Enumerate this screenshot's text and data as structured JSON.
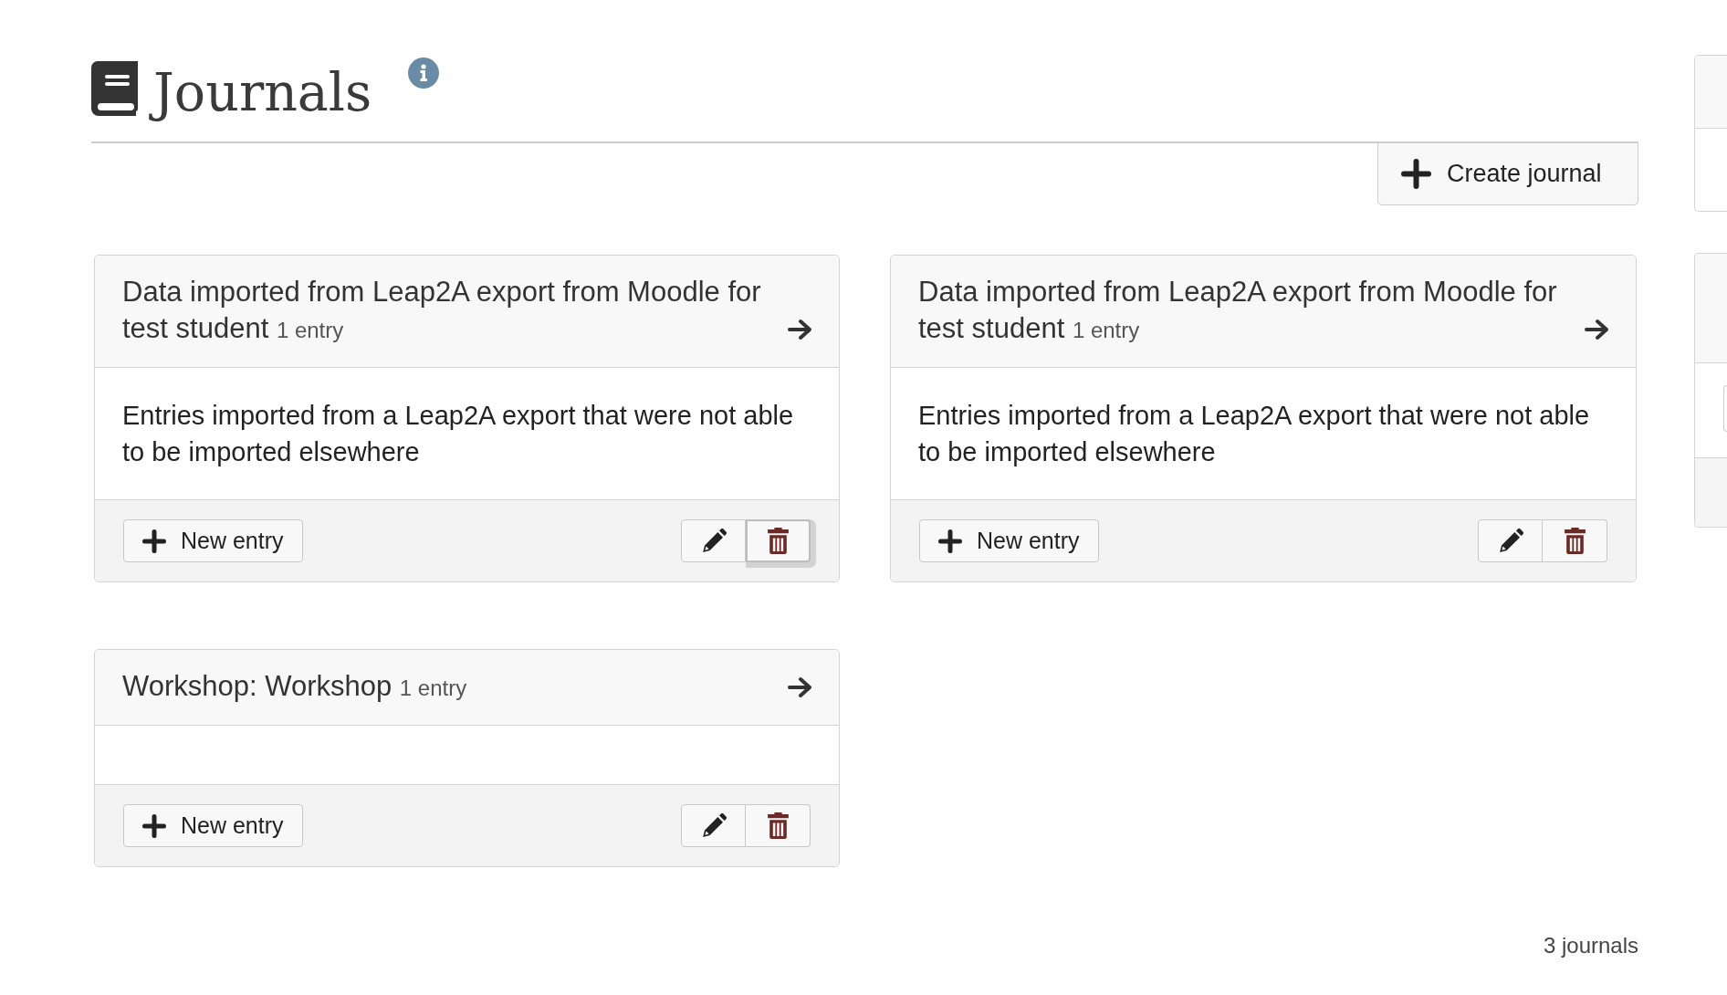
{
  "page": {
    "title": "Journals"
  },
  "toolbar": {
    "create_button": "Create journal"
  },
  "journals": [
    {
      "title": "Data imported from Leap2A export from Moodle for test student",
      "entry_count": "1 entry",
      "description": "Entries imported from a Leap2A export that were not able to be imported elsewhere",
      "new_entry_button": "New entry",
      "delete": {
        "focused": true
      }
    },
    {
      "title": "Data imported from Leap2A export from Moodle for test student",
      "entry_count": "1 entry",
      "description": "Entries imported from a Leap2A export that were not able to be imported elsewhere",
      "new_entry_button": "New entry",
      "delete": {
        "focused": false
      }
    },
    {
      "title": "Workshop: Workshop",
      "entry_count": "1 entry",
      "new_entry_button": "New entry",
      "delete": {
        "focused": false
      }
    }
  ],
  "footer": {
    "count": "3 journals"
  }
}
